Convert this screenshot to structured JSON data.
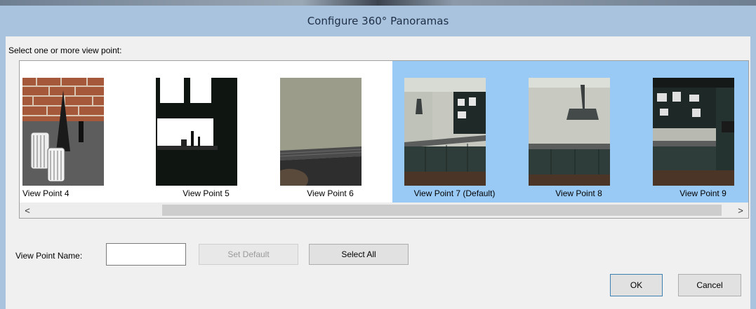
{
  "window": {
    "title": "Configure 360° Panoramas"
  },
  "prompt": "Select one or more view point:",
  "viewpoints": [
    {
      "label": "View Point 4",
      "selected": false
    },
    {
      "label": "View Point 5",
      "selected": false
    },
    {
      "label": "View Point 6",
      "selected": false
    },
    {
      "label": "View Point 7 (Default)",
      "selected": true
    },
    {
      "label": "View Point 8",
      "selected": true
    },
    {
      "label": "View Point 9",
      "selected": true
    }
  ],
  "scrollbar": {
    "left_arrow": "<",
    "right_arrow": ">"
  },
  "form": {
    "name_label": "View Point Name:",
    "name_value": "",
    "set_default_label": "Set Default",
    "select_all_label": "Select All"
  },
  "footer": {
    "ok_label": "OK",
    "cancel_label": "Cancel"
  },
  "colors": {
    "titlebar": "#a9c3df",
    "selection": "#99c9f5",
    "client": "#f0f0f0"
  }
}
